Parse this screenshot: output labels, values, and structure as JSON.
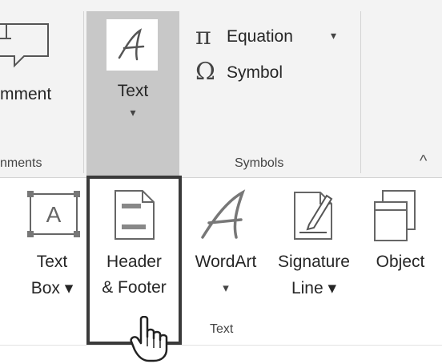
{
  "ribbon": {
    "comment_label": "mment",
    "comments_group": "nments",
    "text_button_label": "Text",
    "text_button_arrow": "▾",
    "equation_label": "Equation",
    "equation_arrow": "▾",
    "symbol_label": "Symbol",
    "symbols_group": "Symbols",
    "collapse_glyph": "^"
  },
  "panel": {
    "items": [
      {
        "line1": "Text",
        "line2": "Box ▾",
        "icon": "text-box-icon"
      },
      {
        "line1": "Header",
        "line2": "& Footer",
        "icon": "header-footer-icon"
      },
      {
        "line1": "WordArt",
        "line2": "▾",
        "icon": "wordart-icon"
      },
      {
        "line1": "Signature",
        "line2": "Line ▾",
        "icon": "signature-line-icon"
      },
      {
        "line1": "Object",
        "line2": "",
        "icon": "object-icon"
      }
    ],
    "group_label": "Text"
  },
  "colors": {
    "highlight_border": "#3a3a3a",
    "pressed_bg": "#c8c8c8",
    "ribbon_bg": "#f3f3f3"
  }
}
